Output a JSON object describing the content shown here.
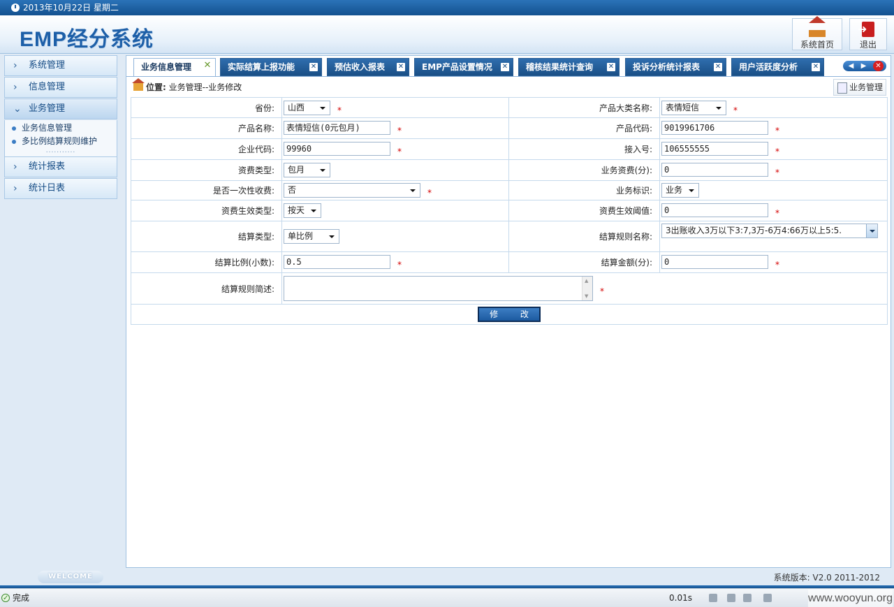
{
  "topbar": {
    "date": "2013年10月22日  星期二"
  },
  "header": {
    "logo": "EMP经分系统",
    "home_label": "系统首页",
    "logout_label": "退出"
  },
  "sidebar": {
    "menu1": "系统管理",
    "menu2": "信息管理",
    "menu3": "业务管理",
    "sub1": "业务信息管理",
    "sub2": "多比例结算规则维护",
    "menu4": "统计报表",
    "menu5": "统计日表",
    "dots": "..........."
  },
  "tabs": {
    "t1": "业务信息管理",
    "t2": "实际结算上报功能",
    "t3": "预估收入报表",
    "t4": "EMP产品设置情况",
    "t5": "稽核结果统计查询",
    "t6": "投诉分析统计报表",
    "t7": "用户活跃度分析"
  },
  "location": {
    "label": "位置:",
    "path": "业务管理--业务修改"
  },
  "biz_button": "业务管理",
  "form": {
    "province_label": "省份:",
    "province_value": "山西",
    "category_label": "产品大类名称:",
    "category_value": "表情短信",
    "product_name_label": "产品名称:",
    "product_name_value": "表情短信(0元包月)",
    "product_code_label": "产品代码:",
    "product_code_value": "9019961706",
    "enterprise_code_label": "企业代码:",
    "enterprise_code_value": "99960",
    "access_no_label": "接入号:",
    "access_no_value": "106555555",
    "fee_type_label": "资费类型:",
    "fee_type_value": "包月",
    "fee_label": "业务资费(分):",
    "fee_value": "0",
    "one_time_label": "是否一次性收费:",
    "one_time_value": "否",
    "biz_flag_label": "业务标识:",
    "biz_flag_value": "业务",
    "effect_type_label": "资费生效类型:",
    "effect_type_value": "按天",
    "effect_threshold_label": "资费生效阈值:",
    "effect_threshold_value": "0",
    "settle_type_label": "结算类型:",
    "settle_type_value": "单比例",
    "rule_name_label": "结算规则名称:",
    "rule_name_value": "3出账收入3万以下3:7,3万-6万4:66万以上5:5.",
    "ratio_label": "结算比例(小数):",
    "ratio_value": "0.5",
    "amount_label": "结算金额(分):",
    "amount_value": "0",
    "rule_desc_label": "结算规则简述:",
    "rule_desc_value": "",
    "required_mark": "*",
    "submit_label": "修 改"
  },
  "footer": {
    "welcome": "WELCOME",
    "version": "系统版本: V2.0 2011-2012"
  },
  "statusbar": {
    "status": "完成",
    "time": "0.01s",
    "watermark": "www.wooyun.org"
  }
}
